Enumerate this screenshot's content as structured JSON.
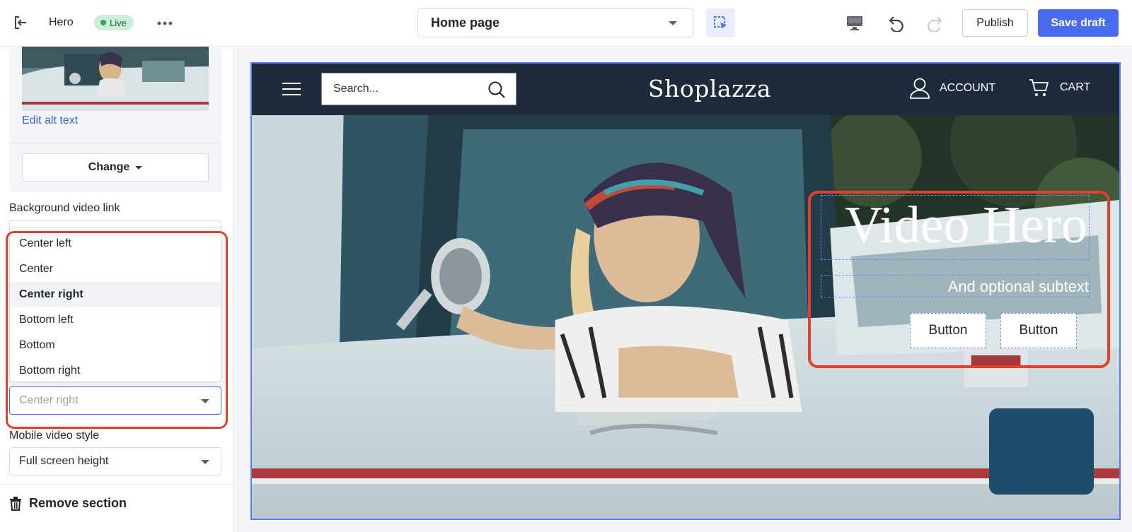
{
  "topbar": {
    "section_name": "Hero",
    "status_badge": "Live",
    "page_select_value": "Home page",
    "publish_label": "Publish",
    "save_label": "Save draft"
  },
  "sidebar": {
    "edit_alt_text": "Edit alt text",
    "change_label": "Change",
    "bg_video_label": "Background video link",
    "text_position_options": [
      "Center left",
      "Center",
      "Center right",
      "Bottom left",
      "Bottom",
      "Bottom right"
    ],
    "text_position_selected": "Center right",
    "mobile_style_label": "Mobile video style",
    "mobile_style_value": "Full screen height",
    "remove_label": "Remove section"
  },
  "preview": {
    "search_placeholder": "Search...",
    "brand": "Shoplazza",
    "account_label": "ACCOUNT",
    "cart_label": "CART",
    "hero_title": "Video Hero",
    "hero_subtext": "And optional subtext",
    "button_1": "Button",
    "button_2": "Button"
  },
  "colors": {
    "accent": "#4a6cf0",
    "highlight": "#e2402b",
    "store_nav": "#1e2b3b",
    "live_badge": "#cdeed6"
  },
  "icons": [
    "exit-icon",
    "more-icon",
    "inspect-icon",
    "desktop-icon",
    "undo-icon",
    "redo-icon",
    "trash-icon",
    "menu-icon",
    "search-icon",
    "account-icon",
    "cart-icon"
  ]
}
